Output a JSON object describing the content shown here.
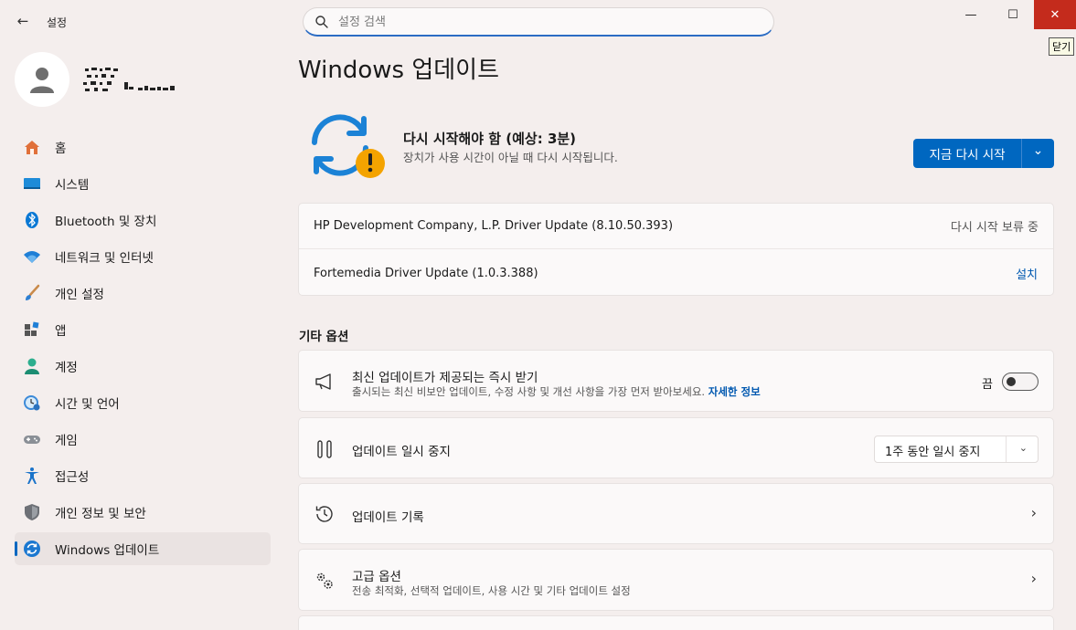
{
  "window": {
    "app_title": "설정",
    "tooltip": "닫기",
    "min_glyph": "—",
    "max_glyph": "☐",
    "close_glyph": "✕",
    "back_glyph": "←"
  },
  "search": {
    "placeholder": "설정 검색"
  },
  "sidebar": {
    "items": [
      {
        "label": "홈",
        "icon": "home-icon"
      },
      {
        "label": "시스템",
        "icon": "system-icon"
      },
      {
        "label": "Bluetooth 및 장치",
        "icon": "bluetooth-icon"
      },
      {
        "label": "네트워크 및 인터넷",
        "icon": "wifi-icon"
      },
      {
        "label": "개인 설정",
        "icon": "brush-icon"
      },
      {
        "label": "앱",
        "icon": "apps-icon"
      },
      {
        "label": "계정",
        "icon": "account-icon"
      },
      {
        "label": "시간 및 언어",
        "icon": "time-language-icon"
      },
      {
        "label": "게임",
        "icon": "gaming-icon"
      },
      {
        "label": "접근성",
        "icon": "accessibility-icon"
      },
      {
        "label": "개인 정보 및 보안",
        "icon": "shield-icon"
      },
      {
        "label": "Windows 업데이트",
        "icon": "update-icon",
        "active": true
      }
    ]
  },
  "main": {
    "title": "Windows 업데이트",
    "status": {
      "title": "다시 시작해야 함 (예상: 3분)",
      "subtitle": "장치가 사용 시간이 아닐 때 다시 시작됩니다."
    },
    "restart_button": {
      "label": "지금 다시 시작",
      "dropdown_glyph": "⌄"
    },
    "updates": [
      {
        "name": "HP Development Company, L.P. Driver Update (8.10.50.393)",
        "status": "다시 시작 보류 중"
      },
      {
        "name": "Fortemedia Driver Update (1.0.3.388)",
        "action": "설치"
      }
    ],
    "other_options": {
      "heading": "기타 옵션",
      "latest": {
        "title": "최신 업데이트가 제공되는 즉시 받기",
        "desc": "출시되는 최신 비보안 업데이트, 수정 사항 및 개선 사항을 가장 먼저 받아보세요.",
        "link": "자세한 정보",
        "toggle_label": "끔",
        "toggle_on": false
      },
      "pause": {
        "title": "업데이트 일시 중지",
        "selected": "1주 동안 일시 중지"
      },
      "history": {
        "title": "업데이트 기록"
      },
      "advanced": {
        "title": "고급 옵션",
        "desc": "전송 최적화, 선택적 업데이트, 사용 시간 및 기타 업데이트 설정"
      }
    }
  },
  "colors": {
    "accent": "#0067c0",
    "close_red": "#c42b1c",
    "warning": "#f4a300"
  }
}
